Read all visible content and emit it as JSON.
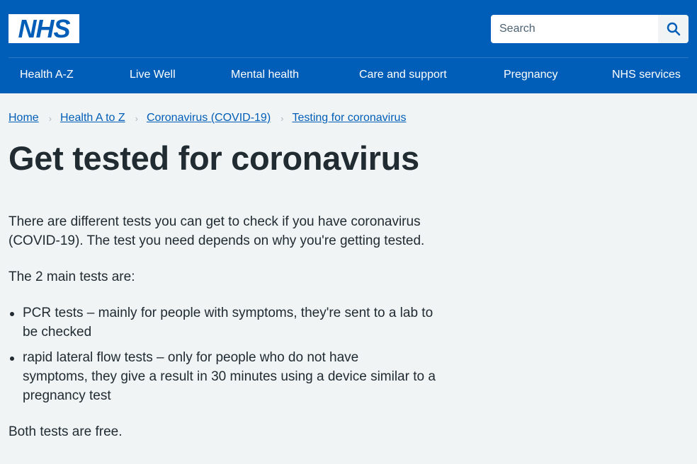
{
  "header": {
    "logo_text": "NHS",
    "search_placeholder": "Search",
    "nav": [
      "Health A-Z",
      "Live Well",
      "Mental health",
      "Care and support",
      "Pregnancy",
      "NHS services"
    ]
  },
  "breadcrumb": [
    "Home",
    "Health A to Z",
    "Coronavirus (COVID-19)",
    "Testing for coronavirus"
  ],
  "main": {
    "title": "Get tested for coronavirus",
    "intro_line1": "There are different tests you can get to check if you have coronavirus",
    "intro_line2": "(COVID-19). The test you need depends on why you're getting tested.",
    "tests_heading": "The 2 main tests are:",
    "bullets": [
      {
        "line1": "PCR tests – mainly for people with symptoms, they're sent to a lab to",
        "line2": "be checked"
      },
      {
        "line1": "rapid lateral flow tests – only for people who do not have",
        "line2": "symptoms, they give a result in 30 minutes using a device similar to a",
        "line3": "pregnancy test"
      }
    ],
    "footer_text": "Both tests are free."
  },
  "colors": {
    "brand": "#005eb8",
    "page_bg": "#f0f4f5",
    "text": "#212b32"
  },
  "icons": {
    "search": "search-icon",
    "separator": "chevron-right-icon"
  }
}
